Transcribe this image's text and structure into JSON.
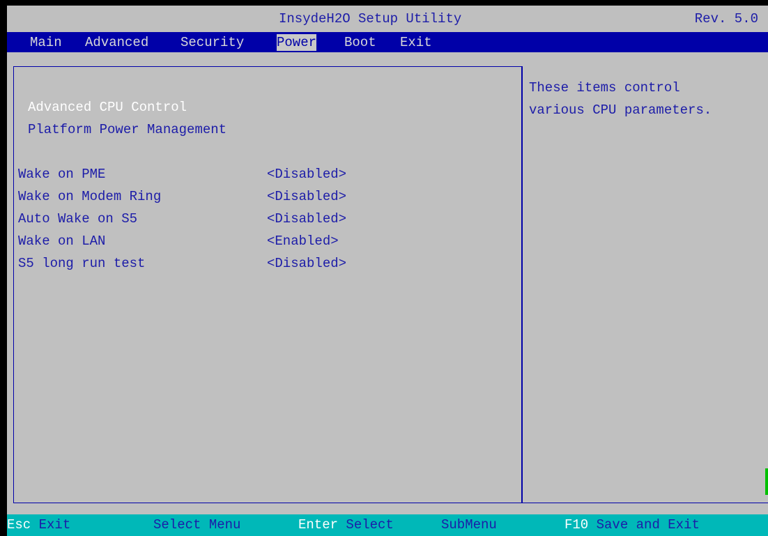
{
  "title_bar": {
    "title": "InsydeH2O Setup Utility",
    "revision": "Rev. 5.0"
  },
  "menu": {
    "items": [
      {
        "label": "Main",
        "active": false
      },
      {
        "label": "Advanced",
        "active": false
      },
      {
        "label": "Security",
        "active": false
      },
      {
        "label": "Power",
        "active": true
      },
      {
        "label": "Boot",
        "active": false
      },
      {
        "label": "Exit",
        "active": false
      }
    ]
  },
  "submenus": [
    {
      "label": "Advanced CPU Control",
      "selected": true
    },
    {
      "label": "Platform Power Management",
      "selected": false
    }
  ],
  "settings": [
    {
      "label": "Wake on PME",
      "value": "<Disabled>"
    },
    {
      "label": "Wake on Modem Ring",
      "value": "<Disabled>"
    },
    {
      "label": "Auto Wake on S5",
      "value": "<Disabled>"
    },
    {
      "label": "Wake on LAN",
      "value": "<Enabled>"
    },
    {
      "label": "S5 long run test",
      "value": "<Disabled>"
    }
  ],
  "help": {
    "lines": [
      "These items control",
      "various CPU parameters."
    ]
  },
  "footer": {
    "items": [
      {
        "key": "Esc",
        "desc": "Exit"
      },
      {
        "key": "",
        "desc": "Select Menu"
      },
      {
        "key": "Enter",
        "desc": "Select"
      },
      {
        "key": "",
        "desc": "SubMenu"
      },
      {
        "key": "F10",
        "desc": "Save and Exit"
      }
    ]
  },
  "colors": {
    "background": "#c0c0c0",
    "menu_bar": "#0000a8",
    "text_blue": "#1c1ca8",
    "footer": "#00b8b8",
    "highlight_text": "#ffffff"
  }
}
